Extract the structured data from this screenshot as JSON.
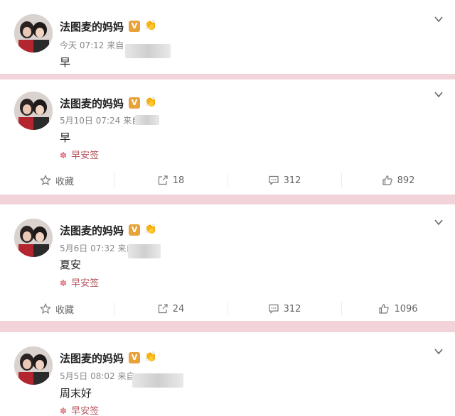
{
  "posts": [
    {
      "name": "法图麦的妈妈",
      "badge": "V",
      "emoji": "👏",
      "time": "今天 07:12",
      "source_prefix": "来自",
      "text": "早"
    },
    {
      "name": "法图麦的妈妈",
      "badge": "V",
      "emoji": "👏",
      "time": "5月10日 07:24",
      "source_prefix": "来自",
      "text": "早",
      "tag": "早安签",
      "actions": {
        "favorite": "收藏",
        "repost": "18",
        "comment": "312",
        "like": "892"
      }
    },
    {
      "name": "法图麦的妈妈",
      "badge": "V",
      "emoji": "👏",
      "time": "5月6日 07:32",
      "source_prefix": "来自",
      "text": "夏安",
      "tag": "早安签",
      "actions": {
        "favorite": "收藏",
        "repost": "24",
        "comment": "312",
        "like": "1096"
      }
    },
    {
      "name": "法图麦的妈妈",
      "badge": "V",
      "emoji": "👏",
      "time": "5月5日 08:02",
      "source_prefix": "来自",
      "text": "周末好",
      "tag": "早安签"
    }
  ],
  "colors": {
    "background": "#f3d3da",
    "badge": "#e8a23a",
    "tag": "#b5565f"
  }
}
